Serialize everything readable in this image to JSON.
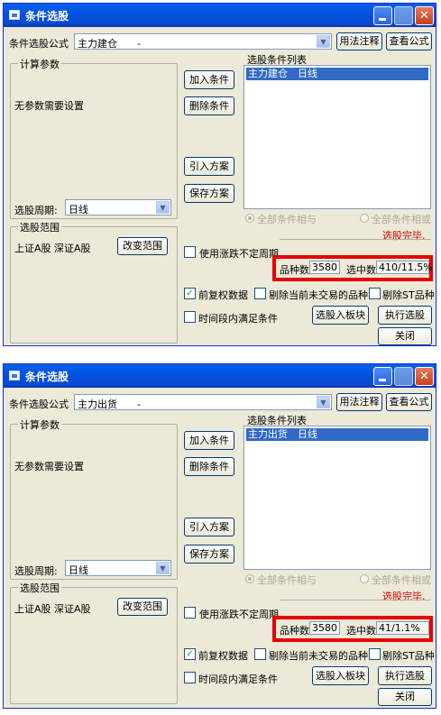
{
  "dialogs": [
    {
      "title": "条件选股",
      "formula_label": "条件选股公式",
      "formula_value": "主力建仓　　-",
      "buttons": {
        "usage": "用法注释",
        "view_formula": "查看公式",
        "add_condition": "加入条件",
        "delete_condition": "删除条件",
        "import_plan": "引入方案",
        "save_plan": "保存方案",
        "change_range": "改变范围",
        "select_to_block": "选股入板块",
        "execute": "执行选股",
        "close": "关闭"
      },
      "params_group": "计算参数",
      "params_text": "无参数需要设置",
      "period_label": "选股周期:",
      "period_value": "日线",
      "range_group": "选股范围",
      "range_text": "上证A股 深证A股",
      "list_title": "选股条件列表",
      "list_items": [
        "主力建仓　日线"
      ],
      "radio_and": "全部条件相与",
      "radio_or": "全部条件相或",
      "status": "选股完毕.",
      "use_period_label": "使用涨跌不定周期",
      "count_label": "品种数",
      "count_value": "3580",
      "selected_label": "选中数",
      "selected_value": "410/11.5%",
      "options": {
        "pre_adjust": "前复权数据",
        "exclude_untraded": "剔除当前未交易的品种",
        "exclude_st": "剔除ST品种",
        "period_satisfy": "时间段内满足条件"
      },
      "checked": {
        "pre_adjust": true,
        "exclude_untraded": false,
        "exclude_st": false,
        "period_satisfy": false,
        "use_period": false
      },
      "window_buttons": {
        "close": "✕"
      }
    },
    {
      "title": "条件选股",
      "formula_label": "条件选股公式",
      "formula_value": "主力出货　　-",
      "buttons": {
        "usage": "用法注释",
        "view_formula": "查看公式",
        "add_condition": "加入条件",
        "delete_condition": "删除条件",
        "import_plan": "引入方案",
        "save_plan": "保存方案",
        "change_range": "改变范围",
        "select_to_block": "选股入板块",
        "execute": "执行选股",
        "close": "关闭"
      },
      "params_group": "计算参数",
      "params_text": "无参数需要设置",
      "period_label": "选股周期:",
      "period_value": "日线",
      "range_group": "选股范围",
      "range_text": "上证A股 深证A股",
      "list_title": "选股条件列表",
      "list_items": [
        "主力出货　日线"
      ],
      "radio_and": "全部条件相与",
      "radio_or": "全部条件相或",
      "status": "选股完毕.",
      "use_period_label": "使用涨跌不定周期",
      "count_label": "品种数",
      "count_value": "3580",
      "selected_label": "选中数",
      "selected_value": "41/1.1%",
      "options": {
        "pre_adjust": "前复权数据",
        "exclude_untraded": "剔除当前未交易的品种",
        "exclude_st": "剔除ST品种",
        "period_satisfy": "时间段内满足条件"
      },
      "checked": {
        "pre_adjust": true,
        "exclude_untraded": false,
        "exclude_st": false,
        "period_satisfy": false,
        "use_period": false
      },
      "window_buttons": {
        "close": "✕"
      }
    }
  ]
}
